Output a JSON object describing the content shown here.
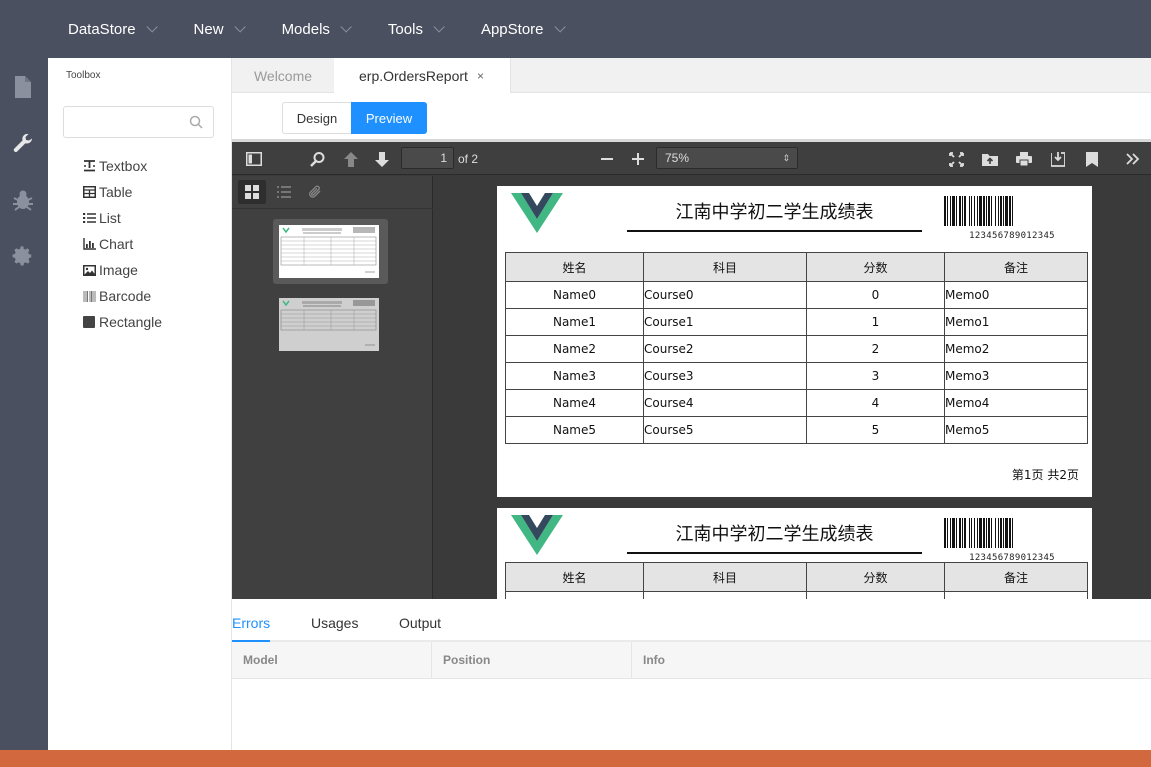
{
  "topnav": {
    "items": [
      {
        "label": "DataStore"
      },
      {
        "label": "New"
      },
      {
        "label": "Models"
      },
      {
        "label": "Tools"
      },
      {
        "label": "AppStore"
      }
    ]
  },
  "rail": {
    "icons": [
      "file-icon",
      "wrench-icon",
      "bug-icon",
      "gear-icon"
    ]
  },
  "toolbox": {
    "title": "Toolbox",
    "search_placeholder": "",
    "items": [
      {
        "label": "Textbox",
        "icon": "textbox-icon"
      },
      {
        "label": "Table",
        "icon": "table-icon"
      },
      {
        "label": "List",
        "icon": "list-icon"
      },
      {
        "label": "Chart",
        "icon": "chart-icon"
      },
      {
        "label": "Image",
        "icon": "image-icon"
      },
      {
        "label": "Barcode",
        "icon": "barcode-icon"
      },
      {
        "label": "Rectangle",
        "icon": "rectangle-icon"
      }
    ]
  },
  "tabs": {
    "welcome": "Welcome",
    "active": "erp.OrdersReport",
    "close": "×"
  },
  "mode": {
    "design": "Design",
    "preview": "Preview"
  },
  "viewer": {
    "page_current": "1",
    "page_of": "of 2",
    "zoom": "75%",
    "zoom_arrow": "⇕"
  },
  "report": {
    "title": "江南中学初二学生成绩表",
    "barcode_text": "123456789012345",
    "headers": [
      "姓名",
      "科目",
      "分数",
      "备注"
    ],
    "rows": [
      [
        "Name0",
        "Course0",
        "0",
        "Memo0"
      ],
      [
        "Name1",
        "Course1",
        "1",
        "Memo1"
      ],
      [
        "Name2",
        "Course2",
        "2",
        "Memo2"
      ],
      [
        "Name3",
        "Course3",
        "3",
        "Memo3"
      ],
      [
        "Name4",
        "Course4",
        "4",
        "Memo4"
      ],
      [
        "Name5",
        "Course5",
        "5",
        "Memo5"
      ]
    ],
    "page_footer": "第1页 共2页"
  },
  "bottom": {
    "tabs": [
      "Errors",
      "Usages",
      "Output"
    ],
    "columns": [
      "Model",
      "Position",
      "Info"
    ]
  },
  "colors": {
    "nav_bg": "#4a5060",
    "accent": "#1e90ff",
    "footer": "#d2693e",
    "logo_green": "#41b883",
    "logo_dark": "#35495e"
  }
}
